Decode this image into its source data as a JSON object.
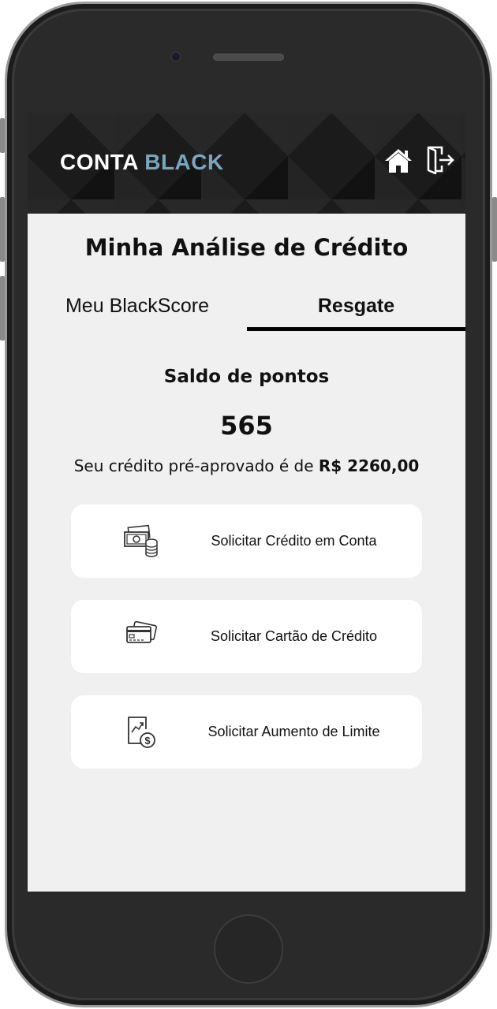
{
  "header": {
    "brand_part1": "CONTA",
    "brand_part2": "BLACK",
    "brand_accent_color": "#7aa6bd",
    "home_icon": "home-icon",
    "logout_icon": "logout-icon"
  },
  "page": {
    "title": "Minha Análise de Crédito"
  },
  "tabs": [
    {
      "label": "Meu BlackScore",
      "active": false
    },
    {
      "label": "Resgate",
      "active": true
    }
  ],
  "balance": {
    "label": "Saldo de pontos",
    "points": "565",
    "credit_prefix": "Seu crédito pré-aprovado é de",
    "credit_value": "R$ 2260,00"
  },
  "actions": [
    {
      "label": "Solicitar Crédito em Conta",
      "icon": "money-coins-icon"
    },
    {
      "label": "Solicitar Cartão de Crédito",
      "icon": "credit-cards-icon"
    },
    {
      "label": "Solicitar Aumento de Limite",
      "icon": "growth-dollar-icon"
    }
  ]
}
